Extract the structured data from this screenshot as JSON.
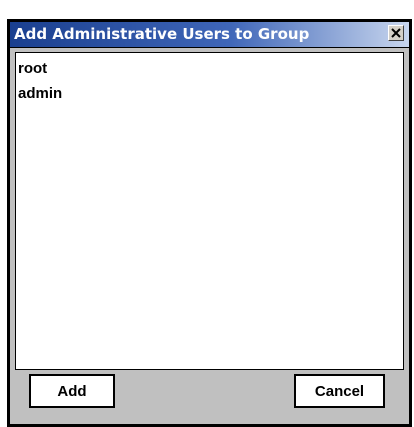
{
  "dialog": {
    "title": "Add Administrative Users to Group",
    "close_icon": "close-icon"
  },
  "users": {
    "items": [
      {
        "label": "root"
      },
      {
        "label": "admin"
      }
    ]
  },
  "buttons": {
    "add_label": "Add",
    "cancel_label": "Cancel"
  },
  "colors": {
    "titlebar_start": "#1a3f8f",
    "titlebar_end": "#c8d6ee",
    "dialog_background": "#c0c0c0"
  }
}
